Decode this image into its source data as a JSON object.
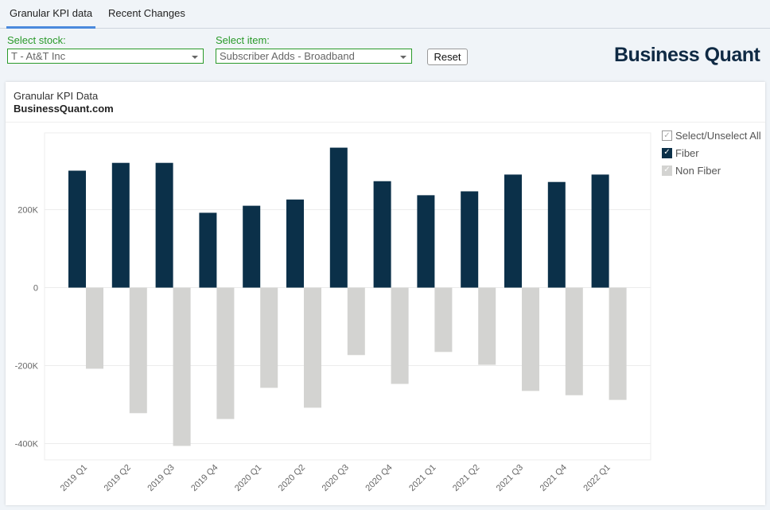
{
  "tabs": [
    {
      "label": "Granular KPI data",
      "active": true
    },
    {
      "label": "Recent Changes",
      "active": false
    }
  ],
  "filters": {
    "stock_label": "Select stock:",
    "stock_value": "T - At&T Inc",
    "item_label": "Select item:",
    "item_value": "Subscriber Adds - Broadband",
    "reset_label": "Reset"
  },
  "logo": "Business Quant",
  "card": {
    "title": "Granular KPI Data",
    "subtitle": "BusinessQuant.com"
  },
  "legend": {
    "all_label": "Select/Unselect All",
    "items": [
      {
        "label": "Fiber",
        "color": "#0b3049",
        "checked": true
      },
      {
        "label": "Non Fiber",
        "color": "#d3d3d1",
        "checked": true
      }
    ]
  },
  "chart_data": {
    "type": "bar",
    "title": "Granular KPI Data",
    "xlabel": "",
    "ylabel": "",
    "ylim": [
      -440000,
      400000
    ],
    "yticks": [
      -400000,
      -200000,
      0,
      200000
    ],
    "ytick_labels": [
      "-400K",
      "-200K",
      "0",
      "200K"
    ],
    "grid": true,
    "legend_position": "right",
    "categories": [
      "2019 Q1",
      "2019 Q2",
      "2019 Q3",
      "2019 Q4",
      "2020 Q1",
      "2020 Q2",
      "2020 Q3",
      "2020 Q4",
      "2021 Q1",
      "2021 Q2",
      "2021 Q3",
      "2021 Q4",
      "2022 Q1"
    ],
    "series": [
      {
        "name": "Fiber",
        "color": "#0b3049",
        "values": [
          300000,
          320000,
          320000,
          192000,
          210000,
          226000,
          359000,
          273000,
          237000,
          247000,
          290000,
          271000,
          290000
        ]
      },
      {
        "name": "Non Fiber",
        "color": "#d3d3d1",
        "values": [
          -208000,
          -322000,
          -406000,
          -337000,
          -257000,
          -308000,
          -173000,
          -247000,
          -165000,
          -198000,
          -265000,
          -276000,
          -288000
        ]
      }
    ]
  }
}
